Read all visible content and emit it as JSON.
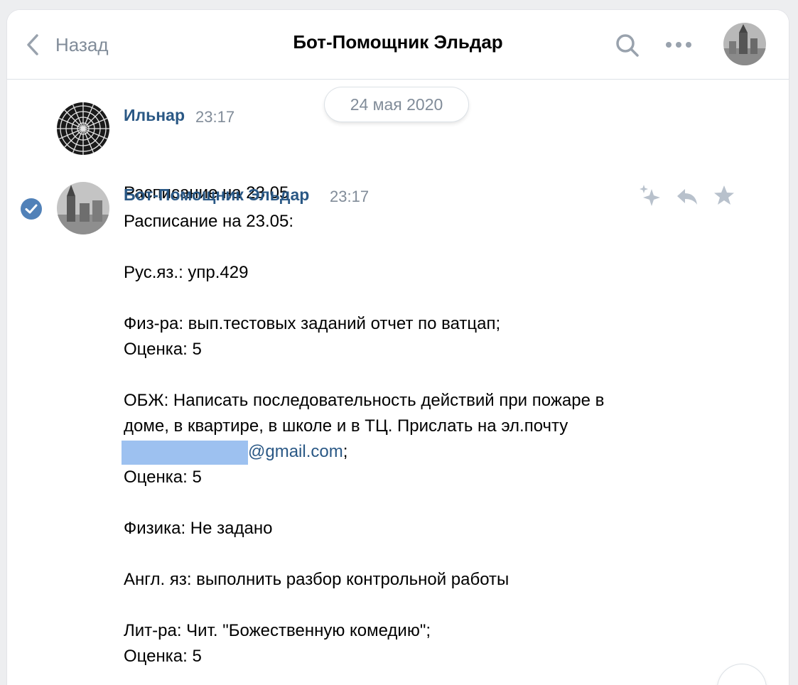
{
  "header": {
    "back_label": "Назад",
    "title": "Бот-Помощник Эльдар"
  },
  "date_separator": "24 мая 2020",
  "messages": [
    {
      "author": "Ильнар",
      "time": "23:17",
      "lines": [
        "Расписание на 23.05"
      ]
    },
    {
      "author": "Бот-Помощник Эльдар",
      "time": "23:17",
      "lines": [
        "Расписание на 23.05:",
        "",
        "Рус.яз.: упр.429",
        "",
        "Физ-ра: вып.тестовых заданий отчет по ватцап;",
        "Оценка: 5",
        "",
        "ОБЖ: Написать последовательность действий при пожаре в",
        "доме, в квартире, в школе и в ТЦ. Прислать на эл.почту",
        "@EMAIL@",
        "Оценка: 5",
        "",
        "Физика: Не задано",
        "",
        "Англ. яз: выполнить разбор контрольной работы",
        "",
        "Лит-ра: Чит. \"Божественную комедию\";",
        "Оценка: 5"
      ],
      "email_domain": "@gmail.com",
      "email_suffix": ";"
    }
  ],
  "icons": {
    "back": "chevron-left-icon",
    "search": "search-icon",
    "more": "more-horizontal-icon",
    "read": "check-circle-icon",
    "ai": "sparkles-icon",
    "reply": "reply-icon",
    "favorite": "star-icon"
  },
  "colors": {
    "link": "#2a5885",
    "muted": "#818c99",
    "accent": "#5181b8",
    "email_mask": "#9dc1f0"
  }
}
